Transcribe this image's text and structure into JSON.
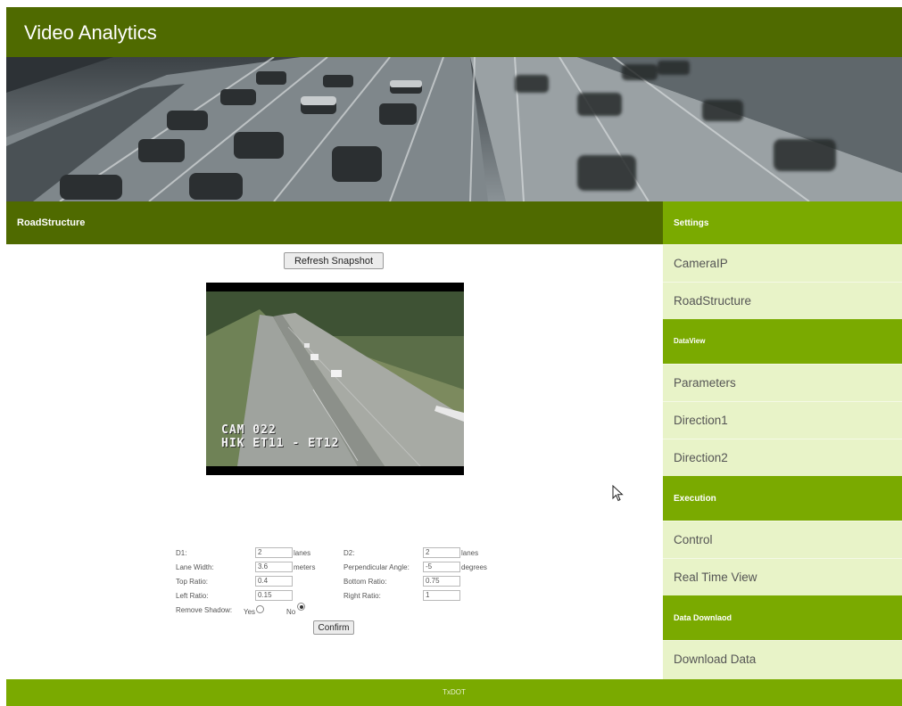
{
  "header": {
    "title": "Video Analytics"
  },
  "section": {
    "title": "RoadStructure"
  },
  "main": {
    "refresh_label": "Refresh Snapshot",
    "snapshot": {
      "line1": "CAM 022",
      "line2": "HIK ET11 - ET12"
    },
    "form": {
      "d1_label": "D1:",
      "d1_value": "2",
      "d1_unit": "lanes",
      "d2_label": "D2:",
      "d2_value": "2",
      "d2_unit": "lanes",
      "lane_width_label": "Lane Width:",
      "lane_width_value": "3.6",
      "lane_width_unit": "meters",
      "perp_angle_label": "Perpendicular Angle:",
      "perp_angle_value": "-5",
      "perp_angle_unit": "degrees",
      "top_ratio_label": "Top Ratio:",
      "top_ratio_value": "0.4",
      "bottom_ratio_label": "Bottom Ratio:",
      "bottom_ratio_value": "0.75",
      "left_ratio_label": "Left Ratio:",
      "left_ratio_value": "0.15",
      "right_ratio_label": "Right Ratio:",
      "right_ratio_value": "1",
      "remove_shadow_label": "Remove Shadow:",
      "yes_label": "Yes",
      "no_label": "No",
      "remove_shadow_selected": "No",
      "confirm_label": "Confirm"
    }
  },
  "sidebar": {
    "settings_header": "Settings",
    "camera_ip": "CameraIP",
    "road_structure": "RoadStructure",
    "dataview_header": "DataView",
    "parameters": "Parameters",
    "direction1": "Direction1",
    "direction2": "Direction2",
    "execution_header": "Execution",
    "control": "Control",
    "real_time_view": "Real Time View",
    "download_header": "Data Downlaod",
    "download_data": "Download Data"
  },
  "footer": {
    "text": "TxDOT"
  },
  "colors": {
    "dark_green": "#4f6a00",
    "light_green": "#7aaa00",
    "menu_bg": "#e8f3c8"
  }
}
